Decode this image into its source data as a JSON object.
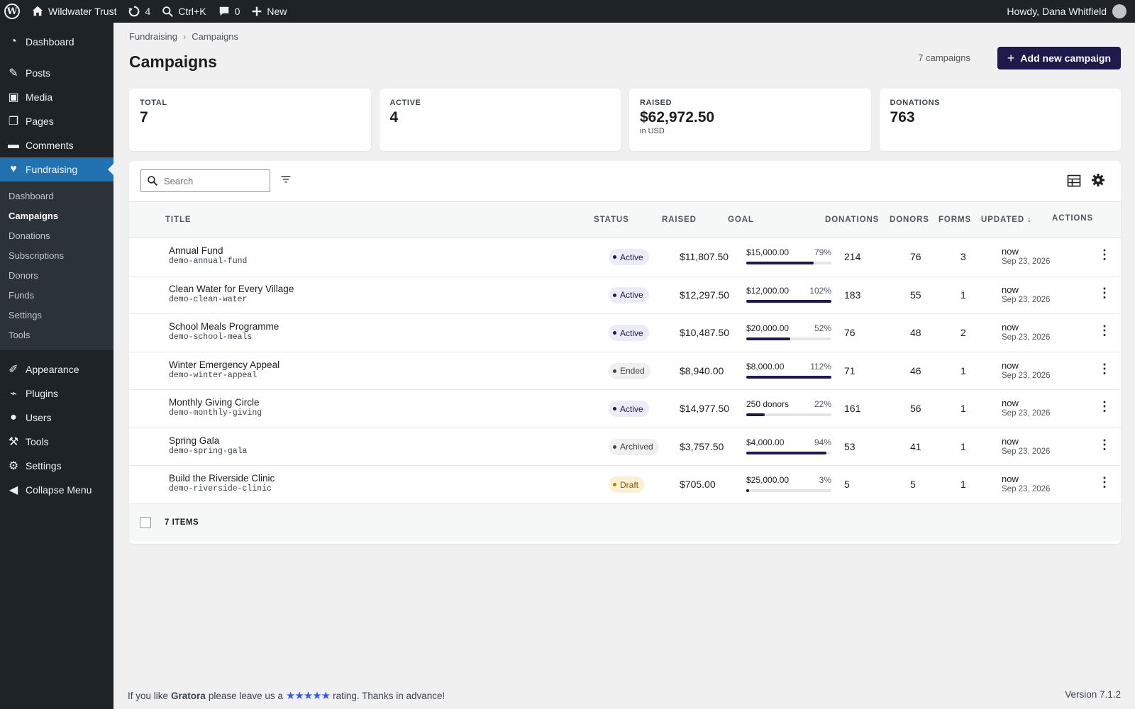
{
  "adminbar": {
    "site_name": "Wildwater Trust",
    "updates_count": "4",
    "search_shortcut": "Ctrl+K",
    "comments_count": "0",
    "new_label": "New",
    "greeting": "Howdy, Dana Whitfield"
  },
  "sidebar": {
    "dashboard": "Dashboard",
    "posts": "Posts",
    "media": "Media",
    "pages": "Pages",
    "comments": "Comments",
    "fundraising": "Fundraising",
    "sub": [
      "Dashboard",
      "Campaigns",
      "Donations",
      "Subscriptions",
      "Donors",
      "Funds",
      "Settings",
      "Tools"
    ],
    "appearance": "Appearance",
    "plugins": "Plugins",
    "users": "Users",
    "tools": "Tools",
    "settings": "Settings",
    "collapse": "Collapse Menu"
  },
  "breadcrumb": {
    "parent": "Fundraising",
    "current": "Campaigns"
  },
  "page_title": "Campaigns",
  "campaign_count": "7 campaigns",
  "add_button": "Add new campaign",
  "stats": {
    "total": {
      "label": "TOTAL",
      "value": "7"
    },
    "active": {
      "label": "ACTIVE",
      "value": "4"
    },
    "raised": {
      "label": "RAISED",
      "value": "$62,972.50",
      "sub": "in USD"
    },
    "donations": {
      "label": "DONATIONS",
      "value": "763"
    }
  },
  "search_placeholder": "Search",
  "columns": {
    "title": "TITLE",
    "status": "STATUS",
    "raised": "RAISED",
    "goal": "GOAL",
    "donations": "DONATIONS",
    "donors": "DONORS",
    "forms": "FORMS",
    "updated": "UPDATED ↓",
    "actions": "ACTIONS"
  },
  "rows": [
    {
      "title": "Annual Fund",
      "slug": "demo-annual-fund",
      "status": "Active",
      "raised": "$11,807.50",
      "goal": "$15,000.00",
      "pct": "79%",
      "progress": 0.79,
      "donations": "214",
      "donors": "76",
      "forms": "3",
      "updated": "now",
      "date": "Sep 23, 2026"
    },
    {
      "title": "Clean Water for Every Village",
      "slug": "demo-clean-water",
      "status": "Active",
      "raised": "$12,297.50",
      "goal": "$12,000.00",
      "pct": "102%",
      "progress": 1.0,
      "donations": "183",
      "donors": "55",
      "forms": "1",
      "updated": "now",
      "date": "Sep 23, 2026"
    },
    {
      "title": "School Meals Programme",
      "slug": "demo-school-meals",
      "status": "Active",
      "raised": "$10,487.50",
      "goal": "$20,000.00",
      "pct": "52%",
      "progress": 0.52,
      "donations": "76",
      "donors": "48",
      "forms": "2",
      "updated": "now",
      "date": "Sep 23, 2026"
    },
    {
      "title": "Winter Emergency Appeal",
      "slug": "demo-winter-appeal",
      "status": "Ended",
      "raised": "$8,940.00",
      "goal": "$8,000.00",
      "pct": "112%",
      "progress": 1.0,
      "donations": "71",
      "donors": "46",
      "forms": "1",
      "updated": "now",
      "date": "Sep 23, 2026"
    },
    {
      "title": "Monthly Giving Circle",
      "slug": "demo-monthly-giving",
      "status": "Active",
      "raised": "$14,977.50",
      "goal": "250 donors",
      "pct": "22%",
      "progress": 0.22,
      "donations": "161",
      "donors": "56",
      "forms": "1",
      "updated": "now",
      "date": "Sep 23, 2026"
    },
    {
      "title": "Spring Gala",
      "slug": "demo-spring-gala",
      "status": "Archived",
      "raised": "$3,757.50",
      "goal": "$4,000.00",
      "pct": "94%",
      "progress": 0.94,
      "donations": "53",
      "donors": "41",
      "forms": "1",
      "updated": "now",
      "date": "Sep 23, 2026"
    },
    {
      "title": "Build the Riverside Clinic",
      "slug": "demo-riverside-clinic",
      "status": "Draft",
      "raised": "$705.00",
      "goal": "$25,000.00",
      "pct": "3%",
      "progress": 0.03,
      "donations": "5",
      "donors": "5",
      "forms": "1",
      "updated": "now",
      "date": "Sep 23, 2026"
    }
  ],
  "status_colors": {
    "Active": {
      "bg": "#ecebf8",
      "text": "#1e1b4b",
      "dot": "#1e1b4b"
    },
    "Ended": {
      "bg": "#f0f0f0",
      "text": "#3c434a",
      "dot": "#3c434a"
    },
    "Archived": {
      "bg": "#f0f0f0",
      "text": "#3c434a",
      "dot": "#3c434a"
    },
    "Draft": {
      "bg": "#fcf0d4",
      "text": "#7a5a00",
      "dot": "#b78100"
    }
  },
  "items_count": "7 ITEMS",
  "footer": {
    "pre": "If you like",
    "brand": "Gratora",
    "mid": "please leave us a",
    "stars": "★★★★★",
    "post": "rating. Thanks in advance!",
    "version": "Version 7.1.2"
  },
  "colors": {
    "accent": "#1e1b4b",
    "wp_blue": "#2271b1",
    "admin_dark": "#1d2327"
  }
}
